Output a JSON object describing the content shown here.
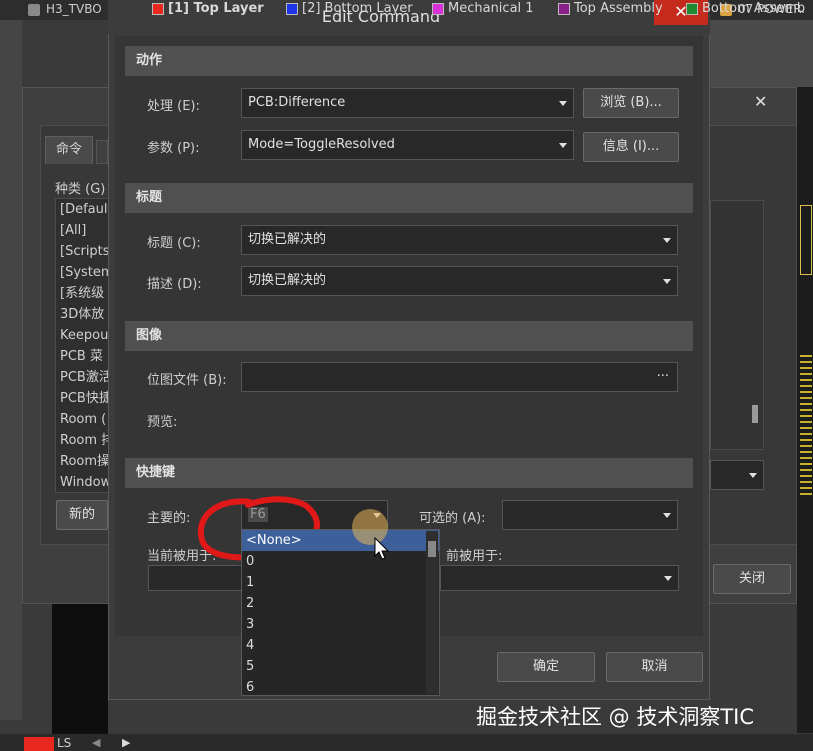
{
  "taskbar": {
    "tab_left": "H3_TVBO",
    "tab_right": "07 POWER."
  },
  "customize": {
    "tab_commands": "命令",
    "category_label": "种类 (G)",
    "categories": [
      "[Default",
      "[All]",
      "[Scripts]",
      "[System",
      "[系统级",
      "3D体放",
      "Keepou",
      "PCB 菜",
      "PCB激活",
      "PCB快捷",
      "Room (",
      "Room 排",
      "Room操",
      "Window"
    ],
    "new_button": "新的",
    "close_button": "关闭"
  },
  "dialog": {
    "title": "Edit Command",
    "sections": {
      "action": "动作",
      "caption": "标题",
      "image": "图像",
      "shortcut": "快捷键"
    },
    "process_label": "处理 (E):",
    "process_value": "PCB:Difference",
    "browse_button": "浏览 (B)...",
    "params_label": "参数 (P):",
    "params_value": "Mode=ToggleResolved",
    "info_button": "信息 (I)...",
    "caption_label": "标题 (C):",
    "caption_value": "切换已解决的",
    "desc_label": "描述 (D):",
    "desc_value": "切换已解决的",
    "bitmap_label": "位图文件 (B):",
    "bitmap_button": "···",
    "preview_label": "预览:",
    "primary_label": "主要的:",
    "primary_value": "F6",
    "alt_label": "可选的 (A):",
    "current_used_label": "当前被用于:",
    "current_used_label_right": "前被用于:",
    "ok_button": "确定",
    "cancel_button": "取消",
    "shortcut_options": [
      "<None>",
      "0",
      "1",
      "2",
      "3",
      "4",
      "5",
      "6"
    ]
  },
  "statusbar": {
    "ls": "LS",
    "layers": [
      {
        "name": "[1] Top Layer",
        "color": "#e8271f"
      },
      {
        "name": "[2] Bottom Layer",
        "color": "#1f34e8"
      },
      {
        "name": "Mechanical 1",
        "color": "#d630d6"
      },
      {
        "name": "Top Assembly",
        "color": "#8a1f8a"
      },
      {
        "name": "Bottom Assemb",
        "color": "#1f8a2e"
      }
    ]
  },
  "watermark": "掘金技术社区 @ 技术洞察TIC"
}
